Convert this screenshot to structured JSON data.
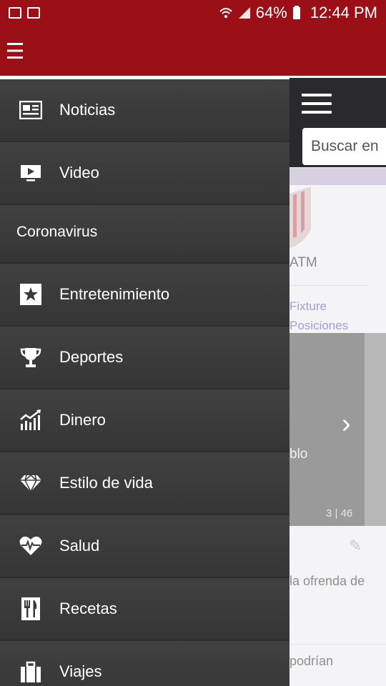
{
  "status_bar": {
    "battery": "64%",
    "time": "12:44 PM"
  },
  "background": {
    "search_placeholder": "Buscar en",
    "abbrev": "ATM",
    "link_1": "Fixture",
    "link_2": "Posiciones",
    "photo_caption": "blo",
    "photo_counter": "3 | 46",
    "snippet_1": "la ofrenda de",
    "snippet_2": "podrían"
  },
  "drawer": {
    "items": [
      {
        "label": "Noticias",
        "icon": "newspaper-icon"
      },
      {
        "label": "Video",
        "icon": "video-icon"
      },
      {
        "section": "Coronavirus"
      },
      {
        "label": "Entretenimiento",
        "icon": "star-icon"
      },
      {
        "label": "Deportes",
        "icon": "trophy-icon"
      },
      {
        "label": "Dinero",
        "icon": "chart-icon"
      },
      {
        "label": "Estilo de vida",
        "icon": "diamond-icon"
      },
      {
        "label": "Salud",
        "icon": "heart-pulse-icon"
      },
      {
        "label": "Recetas",
        "icon": "fork-knife-icon"
      },
      {
        "label": "Viajes",
        "icon": "luggage-icon"
      }
    ]
  },
  "colors": {
    "header": "#9b0f17",
    "drawer_bg": "#3a3a3a"
  }
}
